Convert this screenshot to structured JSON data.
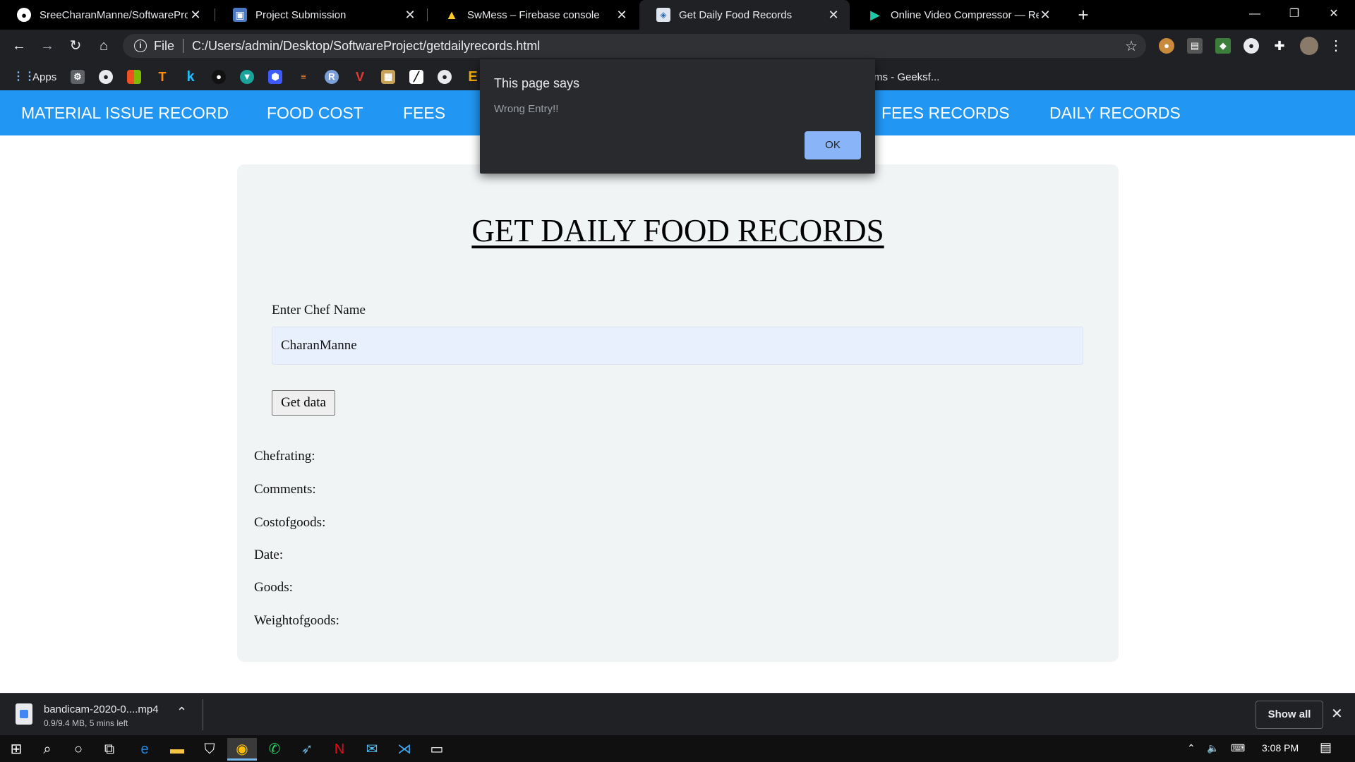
{
  "browser": {
    "tabs": [
      {
        "title": "SreeCharanManne/SoftwareProje",
        "icon": "github-icon"
      },
      {
        "title": "Project Submission",
        "icon": "contact-icon"
      },
      {
        "title": "SwMess – Firebase console",
        "icon": "firebase-icon"
      },
      {
        "title": "Get Daily Food Records",
        "icon": "page-icon",
        "active": true
      },
      {
        "title": "Online Video Compressor — Red",
        "icon": "play-icon"
      }
    ],
    "address": {
      "scheme_label": "File",
      "url": "C:/Users/admin/Desktop/SoftwareProject/getdailyrecords.html"
    },
    "bookmarks": {
      "apps_label": "Apps",
      "geeks_label": "ms - Geeksf..."
    }
  },
  "page": {
    "nav": {
      "items": [
        "MATERIAL ISSUE RECORD",
        "FOOD COST",
        "FEES",
        "FEES RECORDS",
        "DAILY RECORDS"
      ]
    },
    "heading": "GET DAILY FOOD RECORDS",
    "chef_label": "Enter Chef Name",
    "chef_value": "CharanManne",
    "get_button": "Get data",
    "fields": [
      "Chefrating:",
      "Comments:",
      "Costofgoods:",
      "Date:",
      "Goods:",
      "Weightofgoods:"
    ]
  },
  "dialog": {
    "title": "This page says",
    "message": "Wrong Entry!!",
    "ok_label": "OK"
  },
  "downloads": {
    "file_name": "bandicam-2020-0....mp4",
    "progress_text": "0.9/9.4 MB, 5 mins left",
    "show_all": "Show all"
  },
  "taskbar": {
    "time": "3:08 PM"
  },
  "colors": {
    "navbar": "#2196f3",
    "card": "#f1f4f5",
    "input_bg": "#e8f0fe",
    "dialog_bg": "#292a2d",
    "ok_button": "#8ab4f8"
  }
}
